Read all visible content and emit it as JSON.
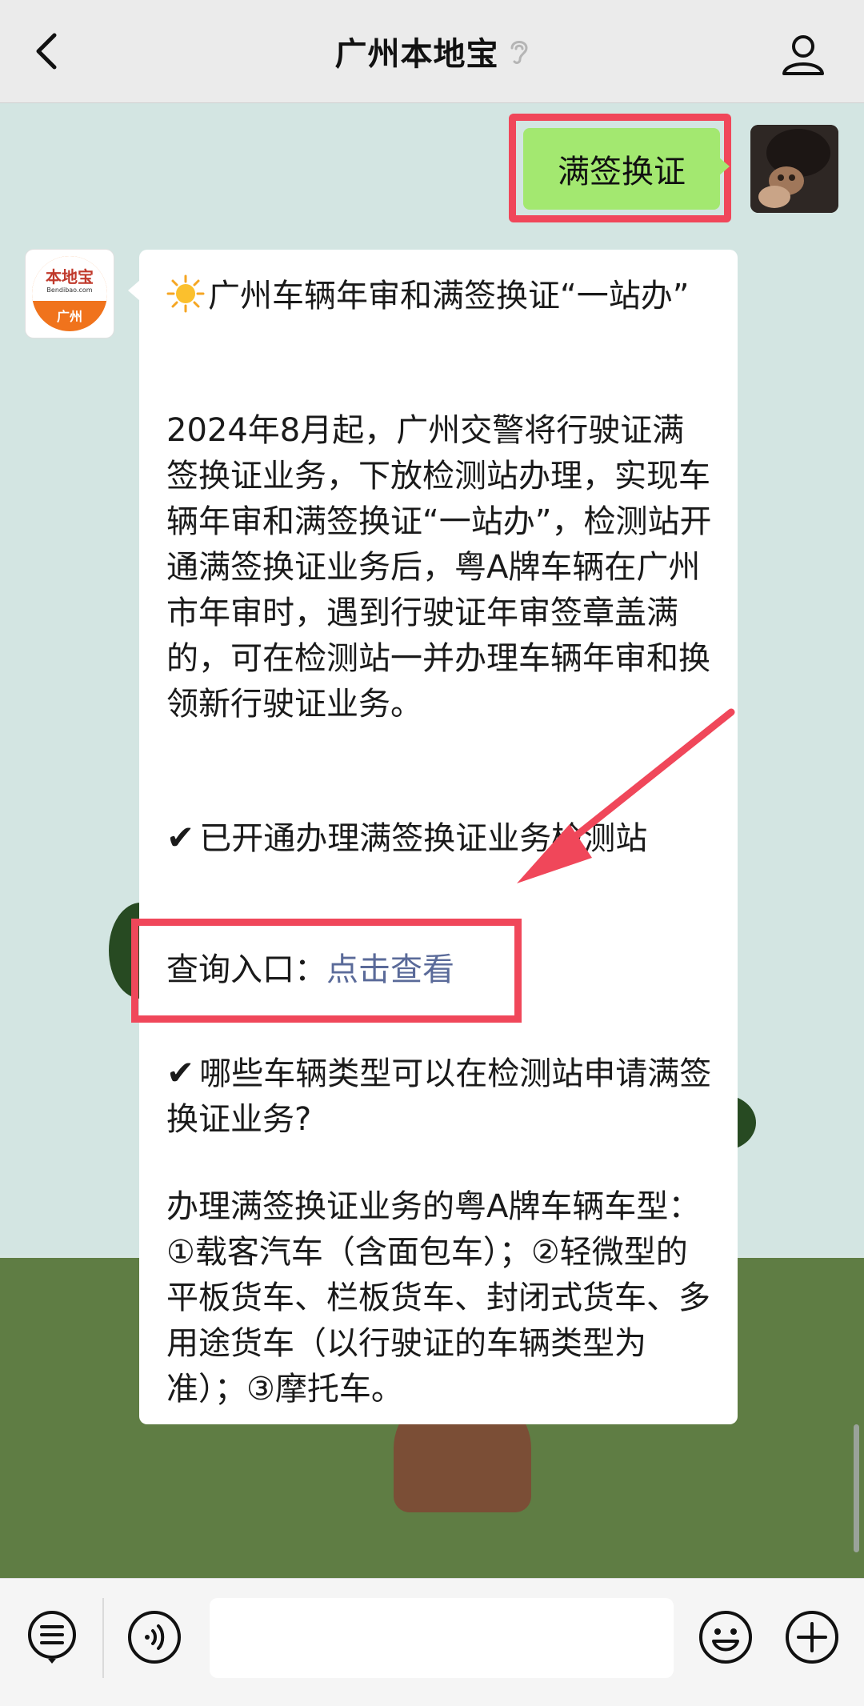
{
  "header": {
    "title": "广州本地宝",
    "back_icon": "chevron-left-icon",
    "ear_icon": "ear-icon",
    "user_icon": "person-icon"
  },
  "outgoing": {
    "text": "满签换证"
  },
  "incoming": {
    "avatar_logo_text": "本地宝",
    "avatar_logo_url": "Bendibao.com",
    "avatar_logo_city": "广州",
    "heading": "广州车辆年审和满签换证“一站办”",
    "body1": "2024年8月起，广州交警将行驶证满签换证业务，下放检测站办理，实现车辆年审和满签换证“一站办”，检测站开通满签换证业务后，粤A牌车辆在广州市年审时，遇到行驶证年审签章盖满的，可在检测站一并办理车辆年审和换领新行驶证业务。",
    "item1": "已开通办理满签换证业务检测站",
    "query_label": "查询入口：",
    "query_link": "点击查看",
    "item2": "哪些车辆类型可以在检测站申请满签换证业务?",
    "body2": "办理满签换证业务的粤A牌车辆车型：①载客汽车（含面包车）；②轻微型的平板货车、栏板货车、封闭式货车、多用途货车（以行驶证的车辆类型为准）；③摩托车。",
    "check_glyph": "✔"
  },
  "bottom_bar": {
    "menu_icon": "list-menu-icon",
    "voice_icon": "voice-icon",
    "input_value": "",
    "emoji_icon": "emoji-icon",
    "plus_icon": "plus-icon"
  },
  "colors": {
    "highlight": "#f0475a",
    "outgoing_bubble": "#a3e870",
    "link": "#5a6a99"
  }
}
